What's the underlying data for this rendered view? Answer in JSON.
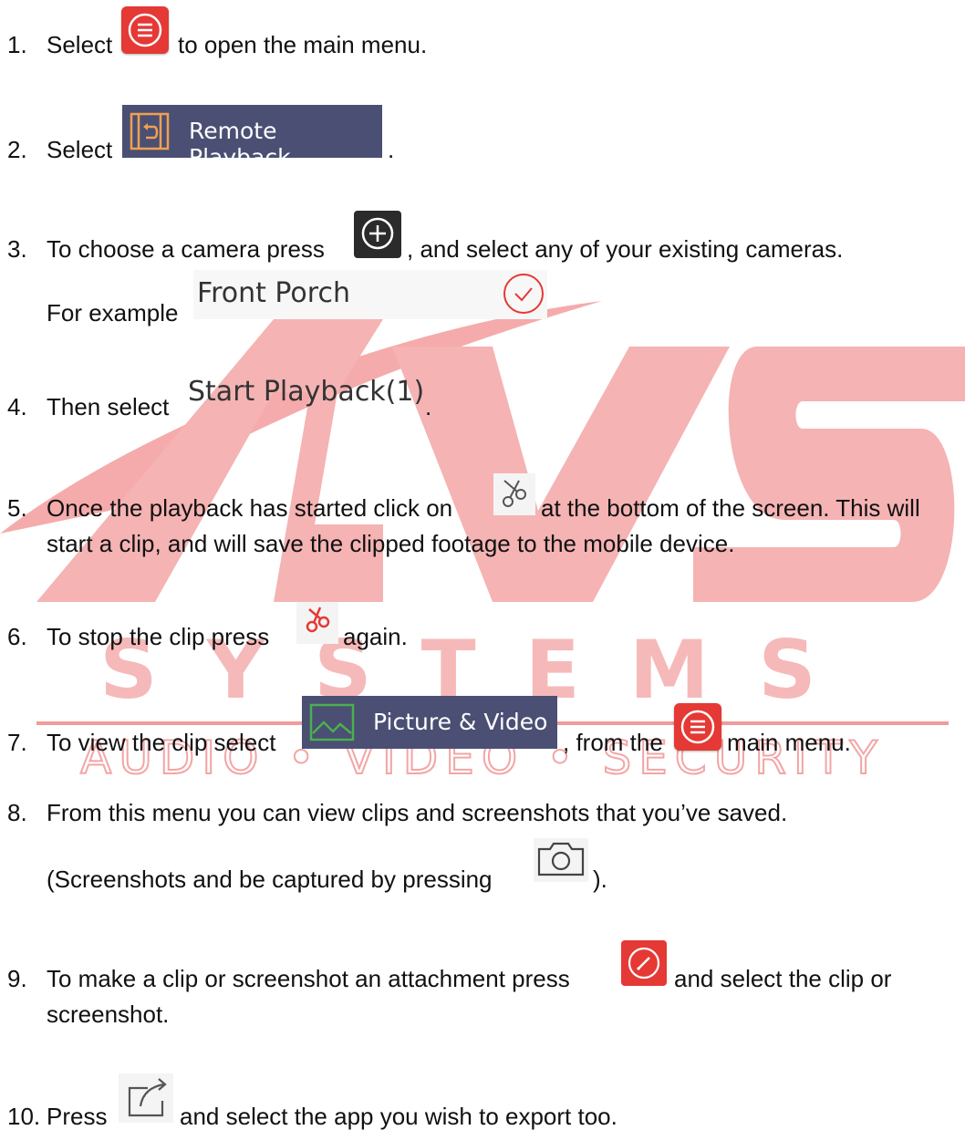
{
  "watermark": {
    "big_letters": "AVS",
    "systems": "SYSTEMS",
    "tagline": "AUDIO • VIDEO • SECURITY",
    "color": "#f08080"
  },
  "steps": [
    {
      "num": "1.",
      "pre": "Select",
      "post": "to open the main menu."
    },
    {
      "num": "2.",
      "pre": "Select",
      "button": "Remote Playback",
      "post": "."
    },
    {
      "num": "3.",
      "pre": "To choose a camera press",
      "post": ", and select any of your existing cameras.",
      "example_label": "For example",
      "example_camera": "Front Porch"
    },
    {
      "num": "4.",
      "pre": "Then select",
      "button": "Start Playback(1)",
      "post": "."
    },
    {
      "num": "5.",
      "pre": "Once the playback has started click on",
      "post": "at the bottom of the screen.  This will",
      "line2": "start a clip, and will save the clipped footage to the mobile device."
    },
    {
      "num": "6.",
      "pre": "To stop the clip press",
      "post": "again."
    },
    {
      "num": "7.",
      "pre": "To view the clip select",
      "button": "Picture & Video",
      "mid": ", from the",
      "post": "main menu."
    },
    {
      "num": "8.",
      "pre": "From this menu you can view clips and screenshots that you’ve saved.",
      "line2_pre": "(Screenshots and be captured by pressing",
      "line2_post": ")."
    },
    {
      "num": "9.",
      "pre": "To make a clip or screenshot an attachment press",
      "post": "and select the clip or",
      "line2": "screenshot."
    },
    {
      "num": "10.",
      "pre": "Press",
      "post": "and select the app you wish to export too."
    }
  ],
  "icons": {
    "menu": "menu-icon",
    "playback": "playback-film-icon",
    "add_camera": "add-camera-icon",
    "check": "check-circle-icon",
    "scissors": "scissors-icon",
    "scissors_active": "scissors-active-icon",
    "picture": "picture-icon",
    "camera": "camera-icon",
    "edit": "edit-icon",
    "share": "share-icon"
  },
  "colors": {
    "accent_red": "#e53935",
    "button_dark": "#4a4f73"
  }
}
